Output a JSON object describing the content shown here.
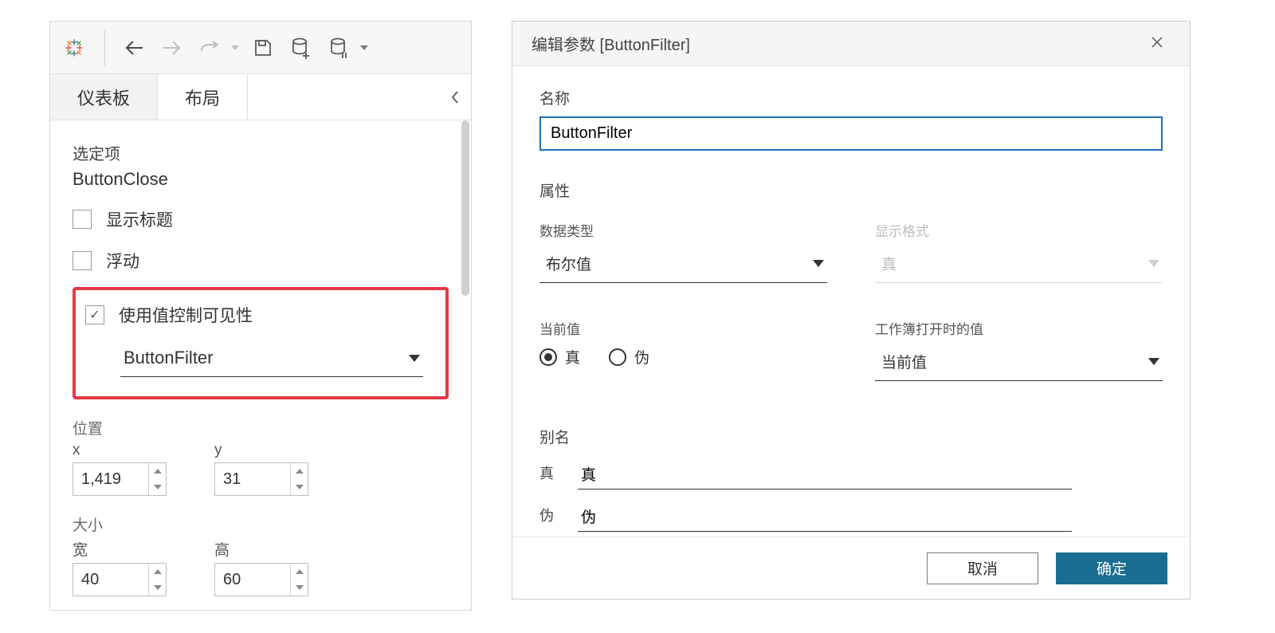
{
  "left": {
    "tabs": {
      "dashboard": "仪表板",
      "layout": "布局"
    },
    "selected_label": "选定项",
    "selected_name": "ButtonClose",
    "show_title": "显示标题",
    "floating": "浮动",
    "control_visibility": "使用值控制可见性",
    "visibility_param": "ButtonFilter",
    "position_label": "位置",
    "x_label": "x",
    "y_label": "y",
    "x_value": "1,419",
    "y_value": "31",
    "size_label": "大小",
    "w_label": "宽",
    "h_label": "高",
    "w_value": "40",
    "h_value": "60"
  },
  "dialog": {
    "title": "编辑参数 [ButtonFilter]",
    "name_label": "名称",
    "name_value": "ButtonFilter",
    "props_label": "属性",
    "datatype_label": "数据类型",
    "datatype_value": "布尔值",
    "display_format_label": "显示格式",
    "display_format_value": "真",
    "current_value_label": "当前值",
    "radio_true": "真",
    "radio_false": "伪",
    "open_value_label": "工作簿打开时的值",
    "open_value_value": "当前值",
    "alias_label": "别名",
    "alias_true_key": "真",
    "alias_true_val": "真",
    "alias_false_key": "伪",
    "alias_false_val": "伪",
    "cancel": "取消",
    "ok": "确定"
  }
}
